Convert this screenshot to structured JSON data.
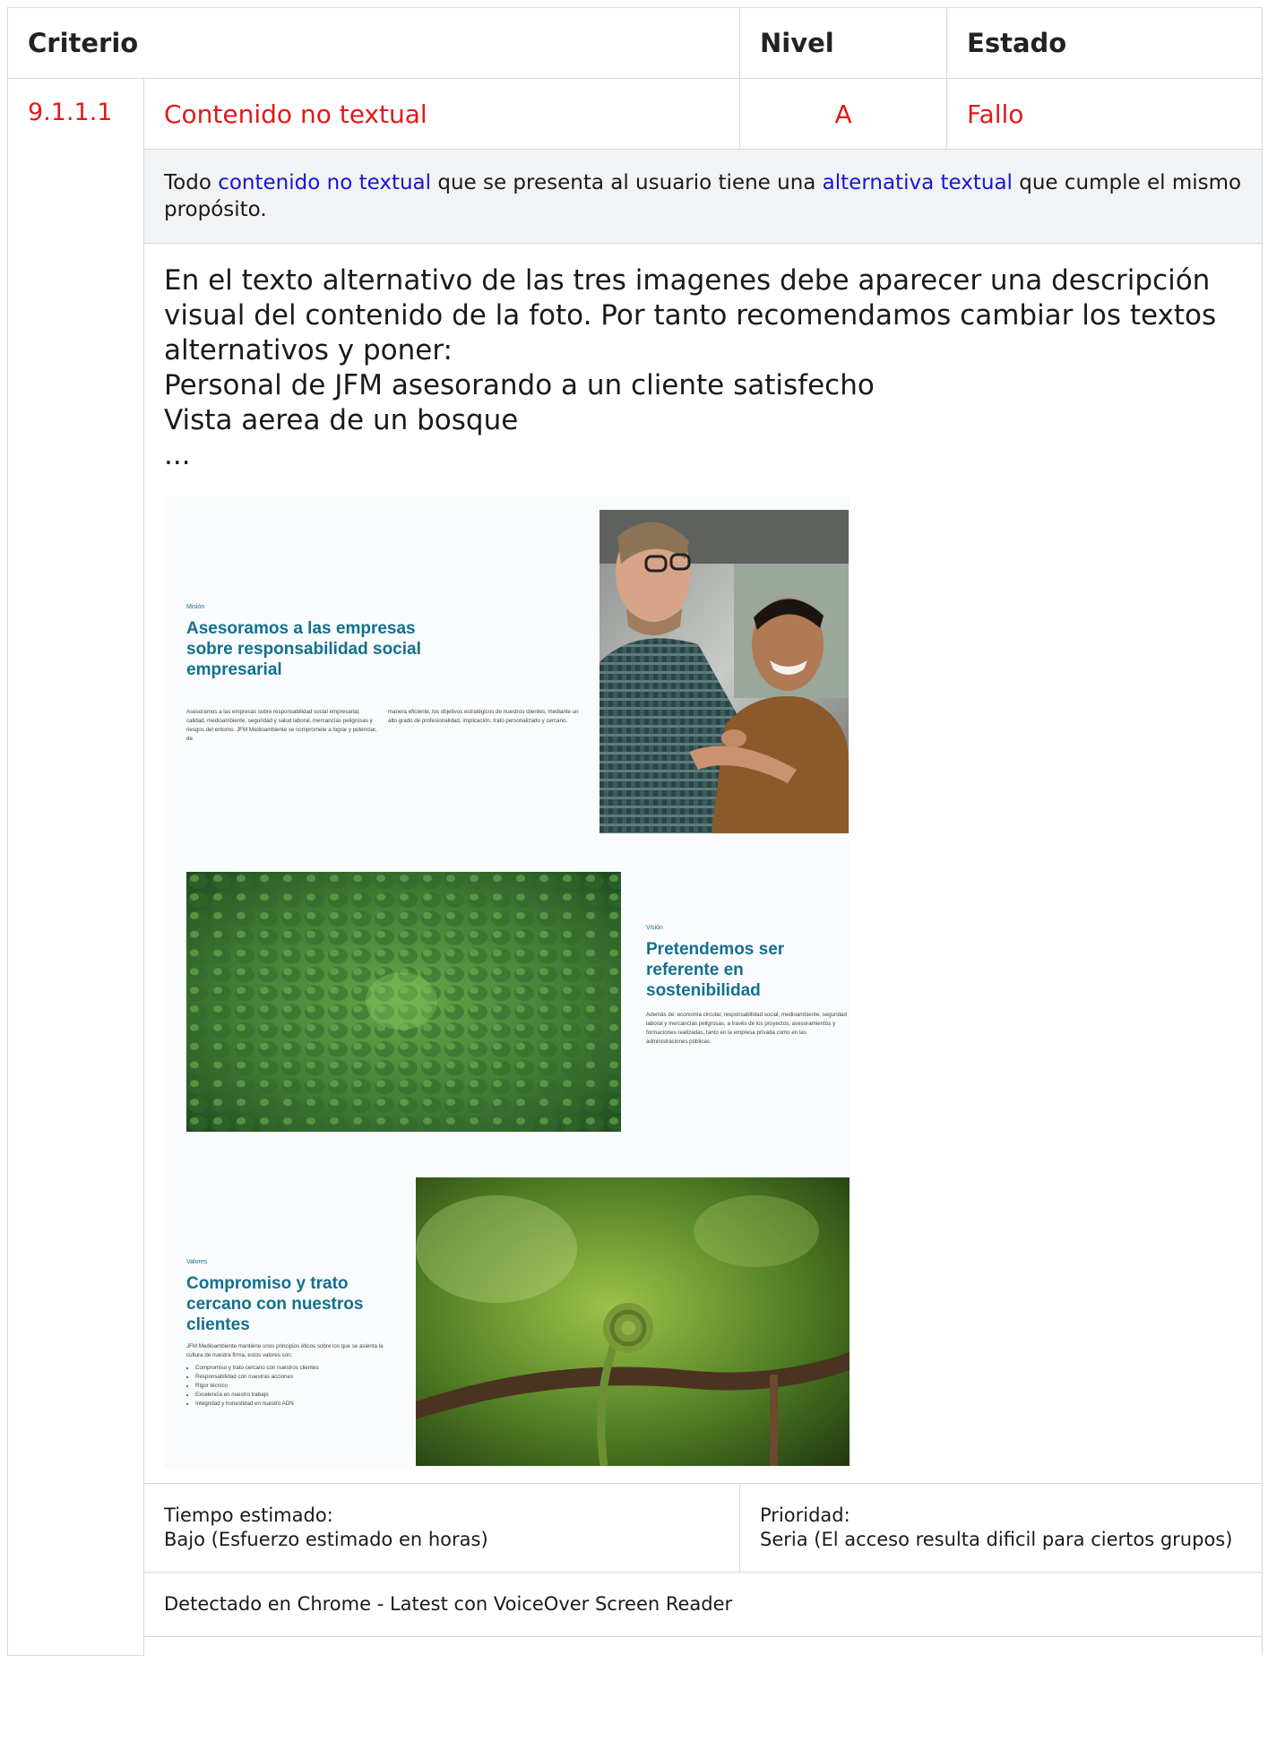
{
  "header": {
    "criterio": "Criterio",
    "nivel": "Nivel",
    "estado": "Estado"
  },
  "criterion": {
    "code": "9.1.1.1",
    "name": "Contenido no textual",
    "level": "A",
    "status": "Fallo"
  },
  "description": {
    "p1": "Todo ",
    "link1": "contenido no textual",
    "p2": " que se presenta al usuario tiene una ",
    "link2": "alternativa textual",
    "p3": " que cumple el mismo propósito."
  },
  "observation": {
    "lines": [
      "En el texto alternativo de las tres imagenes debe aparecer una descripción visual del contenido de la foto. Por tanto recomendamos cambiar los textos alternativos y poner:",
      "Personal de JFM asesorando a un cliente satisfecho",
      "Vista aerea de un bosque",
      "..."
    ]
  },
  "slides": {
    "s1": {
      "eyebrow": "Misión",
      "title": "Asesoramos a las empresas sobre responsabilidad social empresarial",
      "col1": "Asesoramos a las empresas sobre responsabilidad social empresarial, calidad, medioambiente, seguridad y salud laboral, mercancías peligrosas y riesgos del entorno. JFM Medioambiente se compromete a lograr y potenciar, de",
      "col2": "manera eficiente, los objetivos estratégicos de nuestros clientes, mediante un alto grado de profesionalidad, implicación, trato personalizado y cercano."
    },
    "s2": {
      "eyebrow": "Visión",
      "title": "Pretendemos ser referente en sostenibilidad",
      "body": "Además de: economía circular, responsabilidad social, medioambiente, seguridad laboral y mercancías peligrosas, a través de los proyectos, asesoramientos y formaciones realizadas, tanto en la empresa privada como en las administraciones públicas."
    },
    "s3": {
      "eyebrow": "Valores",
      "title": "Compromiso y trato cercano con nuestros clientes",
      "body": "JFM Medioambiente mantiene unos principios éticos sobre los que se asienta la cultura de nuestra firma, estos valores son:",
      "items": [
        "Compromiso y trato cercano con nuestros clientes",
        "Responsabilidad con nuestras acciones",
        "Rigor técnico",
        "Excelencia en nuestro trabajo",
        "Integridad y honestidad en nuestro ADN"
      ]
    }
  },
  "footer": {
    "tiempo_label": "Tiempo estimado:",
    "tiempo_value": "Bajo (Esfuerzo estimado en horas)",
    "prioridad_label": "Prioridad:",
    "prioridad_value": "Seria (El acceso resulta dificil para ciertos grupos)",
    "detected": "Detectado en Chrome - Latest con VoiceOver Screen Reader"
  },
  "colors": {
    "fail": "#e11919",
    "link": "#1a12d6",
    "slide_title": "#12708f"
  }
}
